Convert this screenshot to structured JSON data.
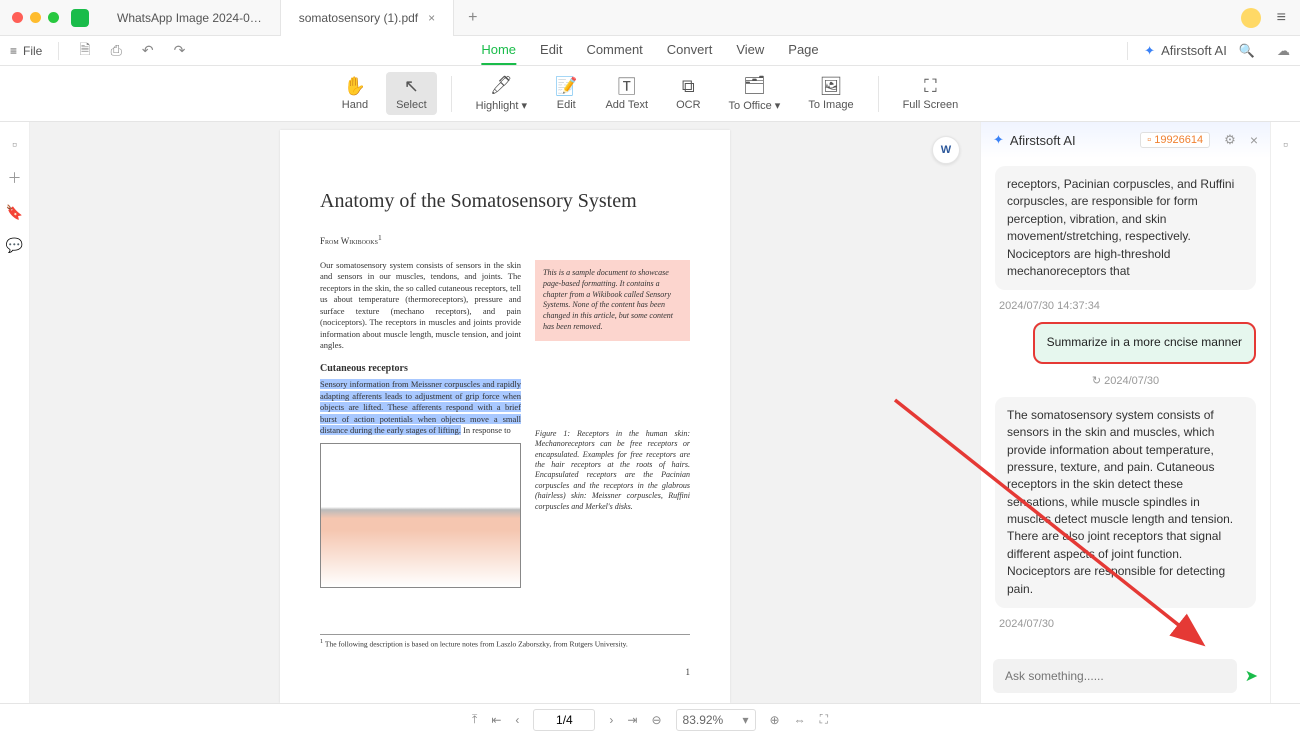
{
  "tabs": [
    {
      "label": "WhatsApp Image 2024-0…"
    },
    {
      "label": "somatosensory (1).pdf"
    }
  ],
  "menubar": {
    "file": "File",
    "items": [
      "Home",
      "Edit",
      "Comment",
      "Convert",
      "View",
      "Page"
    ],
    "ai_label": "Afirstsoft AI"
  },
  "toolbar": {
    "hand": "Hand",
    "select": "Select",
    "highlight": "Highlight",
    "edit": "Edit",
    "add_text": "Add Text",
    "ocr": "OCR",
    "to_office": "To Office",
    "to_image": "To Image",
    "full_screen": "Full Screen"
  },
  "document": {
    "title": "Anatomy of the Somatosensory System",
    "from": "From Wikibooks",
    "from_sup": "1",
    "para1": "Our somatosensory system consists of sensors in the skin and sensors in our muscles, tendons, and joints. The receptors in the skin, the so called cutaneous receptors, tell us about temperature (thermoreceptors), pressure and surface texture (mechano receptors), and pain (nociceptors). The receptors in muscles and joints provide information about muscle length, muscle tension, and joint angles.",
    "note": "This is a sample document to showcase page-based formatting. It contains a chapter from a Wikibook called Sensory Systems. None of the content has been changed in this article, but some content has been removed.",
    "subhead": "Cutaneous receptors",
    "para2_hl": "Sensory information from Meissner corpuscles and rapidly adapting afferents leads to adjustment of grip force when objects are lifted. These afferents respond with a brief burst of action potentials when objects move a small distance during the early stages of lifting.",
    "para2_tail": " In response to",
    "fig_caption": "Figure 1:  Receptors in the human skin: Mechanoreceptors can be free receptors or encapsulated. Examples for free receptors are the hair receptors at the roots of hairs. Encapsulated receptors are the Pacinian corpuscles and the receptors in the glabrous (hairless) skin: Meissner corpuscles, Ruffini corpuscles and Merkel's disks.",
    "footnote_sup": "1",
    "footnote": " The following description is based on lecture notes from Laszlo Zaborszky, from Rutgers University.",
    "page_num": "1"
  },
  "ai_panel": {
    "title": "Afirstsoft AI",
    "badge_num": "19926614",
    "msg1": "receptors, Pacinian corpuscles, and Ruffini corpuscles, are responsible for form perception, vibration, and skin movement/stretching, respectively. Nociceptors are high-threshold mechanoreceptors that",
    "time1": "2024/07/30 14:37:34",
    "user_msg": "Summarize in a more cncise manner",
    "time_user": "2024/07/30",
    "msg2": "The somatosensory system consists of sensors in the skin and muscles, which provide information about temperature, pressure, texture, and pain. Cutaneous receptors in the skin detect these sensations, while muscle spindles in muscles detect muscle length and tension. There are also joint receptors that signal different aspects of joint function. Nociceptors are responsible for detecting pain.",
    "time2": "2024/07/30",
    "input_placeholder": "Ask something......"
  },
  "statusbar": {
    "page": "1/4",
    "zoom": "83.92%"
  }
}
